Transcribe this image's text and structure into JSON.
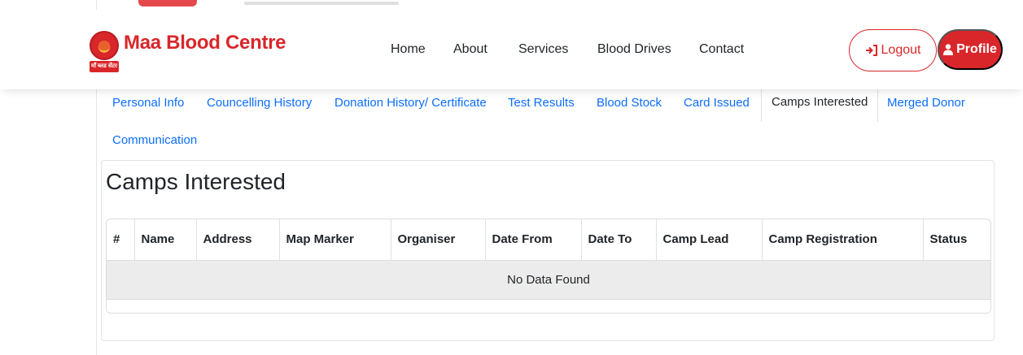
{
  "brand": {
    "name": "Maa Blood Centre",
    "logo_caption": "माँ ब्लड सेंटर"
  },
  "nav": {
    "links": [
      "Home",
      "About",
      "Services",
      "Blood Drives",
      "Contact"
    ],
    "logout_label": "Logout",
    "profile_label": "Profile"
  },
  "tabs": {
    "items": [
      "Personal Info",
      "Councelling History",
      "Donation History/ Certificate",
      "Test Results",
      "Blood Stock",
      "Card Issued",
      "Camps Interested",
      "Merged Donor",
      "Communication"
    ],
    "active": "Camps Interested"
  },
  "section": {
    "title": "Camps Interested"
  },
  "table": {
    "columns": [
      "#",
      "Name",
      "Address",
      "Map Marker",
      "Organiser",
      "Date From",
      "Date To",
      "Camp Lead",
      "Camp Registration",
      "Status"
    ],
    "empty_message": "No Data Found"
  },
  "colors": {
    "brand_red": "#d9262a",
    "link_blue": "#0d6efd"
  }
}
